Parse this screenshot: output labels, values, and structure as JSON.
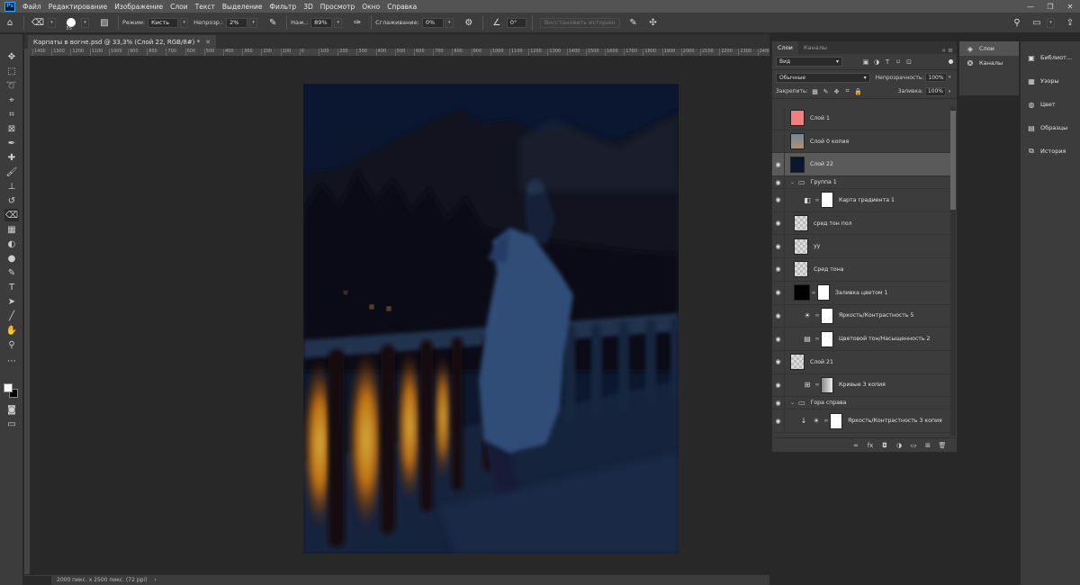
{
  "menu": {
    "logo": "Ps",
    "items": [
      "Файл",
      "Редактирование",
      "Изображение",
      "Слои",
      "Текст",
      "Выделение",
      "Фильтр",
      "3D",
      "Просмотр",
      "Окно",
      "Справка"
    ],
    "window_controls": [
      "—",
      "❐",
      "✕"
    ]
  },
  "options": {
    "brush_size": "35",
    "mode_label": "Режим:",
    "mode_value": "Кисть",
    "opacity_label": "Непрозр.:",
    "opacity_value": "2%",
    "flow_label": "Наж.:",
    "flow_value": "89%",
    "smoothing_label": "Сглаживание:",
    "smoothing_value": "0%",
    "angle_value": "0°",
    "erase_history": "Восстановить историю"
  },
  "document": {
    "tab_title": "Карпаты в вогне.psd @ 33,3% (Слой 22, RGB/8#) *",
    "status": "2000 пикс. x 2500 пикс. (72 ppi)"
  },
  "ruler_ticks": [
    "1400",
    "1300",
    "1200",
    "1100",
    "1000",
    "900",
    "800",
    "700",
    "600",
    "500",
    "400",
    "300",
    "200",
    "100",
    "0",
    "100",
    "200",
    "300",
    "400",
    "500",
    "600",
    "700",
    "800",
    "900",
    "1000",
    "1100",
    "1200",
    "1300",
    "1400",
    "1500",
    "1600",
    "1700",
    "1800",
    "1900",
    "2000",
    "2100",
    "2200",
    "2300",
    "2400"
  ],
  "layers_panel": {
    "tab_layers": "Слои",
    "tab_channels": "Каналы",
    "filter_value": "Вид",
    "blend_value": "Обычные",
    "opacity_label": "Непрозрачность:",
    "opacity_value": "100%",
    "lock_label": "Закрепить:",
    "fill_label": "Заливка:",
    "fill_value": "100%",
    "layers": [
      {
        "name": "Слой 1",
        "visible": false,
        "kind": "pink"
      },
      {
        "name": "Слой 0 копия",
        "visible": false,
        "kind": "photo"
      },
      {
        "name": "Слой 22",
        "visible": true,
        "kind": "dark",
        "selected": true
      },
      {
        "name": "Группа 1",
        "visible": true,
        "kind": "group"
      },
      {
        "name": "Карта градиента 1",
        "visible": true,
        "kind": "adjust",
        "icon": "◧"
      },
      {
        "name": "сред тон пол",
        "visible": true,
        "kind": "checker"
      },
      {
        "name": "уу",
        "visible": true,
        "kind": "checker"
      },
      {
        "name": "Сред тона",
        "visible": true,
        "kind": "checker"
      },
      {
        "name": "Заливка цветом 1",
        "visible": true,
        "kind": "fill"
      },
      {
        "name": "Яркость/Контрастность 5",
        "visible": true,
        "kind": "adjust",
        "icon": "☀"
      },
      {
        "name": "Цветовой тон/Насыщенность 2",
        "visible": true,
        "kind": "adjust",
        "icon": "▤"
      },
      {
        "name": "Слой 21",
        "visible": true,
        "kind": "checker-top"
      },
      {
        "name": "Кривые 3 копия",
        "visible": true,
        "kind": "curves",
        "icon": "⊞"
      },
      {
        "name": "Гора справа",
        "visible": true,
        "kind": "group-top"
      },
      {
        "name": "Яркость/Контрастность 3 копия",
        "visible": true,
        "kind": "adjust",
        "icon": "☀"
      }
    ]
  },
  "dock": {
    "left": [
      "Слои",
      "Каналы"
    ],
    "right": [
      "Библиот...",
      "Узоры",
      "Цвет",
      "Образцы",
      "История"
    ]
  }
}
